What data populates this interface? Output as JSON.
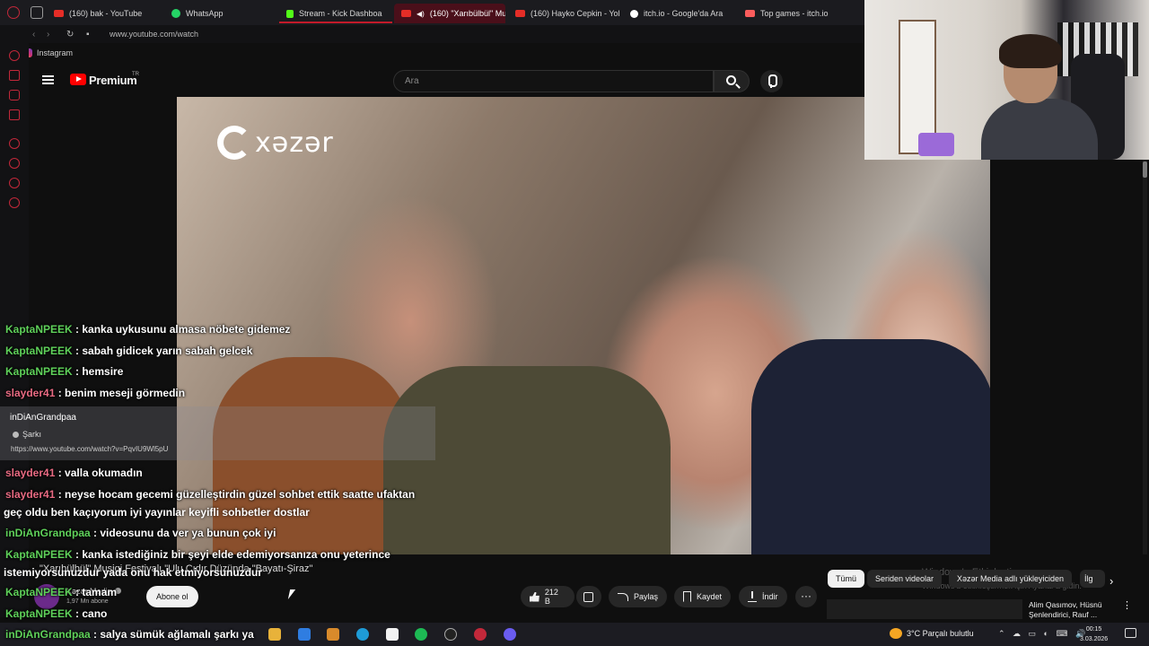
{
  "browser": {
    "tabs": [
      {
        "label": "(160) bak - YouTube",
        "fav": "#e52d27"
      },
      {
        "label": "WhatsApp",
        "fav": "#25d366"
      },
      {
        "label": "Stream - Kick Dashboa",
        "fav": "#53fc18"
      },
      {
        "label": "(160) \"Xarıbülbül\" Mus",
        "fav": "#e52d27",
        "active": true
      },
      {
        "label": "(160) Hayko Cepkin - Yol",
        "fav": "#e52d27"
      },
      {
        "label": "itch.io - Google'da Ara",
        "fav": "#ffffff"
      },
      {
        "label": "Top games - itch.io",
        "fav": "#fa5c5c"
      }
    ],
    "url": "www.youtube.com/watch",
    "bookmark": "Instagram"
  },
  "youtube": {
    "brand": "Premium",
    "brand_sup": "TR",
    "search_placeholder": "Ara",
    "channel_watermark": "xəzər",
    "video_title": "\"Xarıbülbül\" Musiqi Festivalı \"Ulu Cıdır Düzündə \"Bayatı-Şiraz\"",
    "channel": {
      "name": "Xəzər Media",
      "subs": "1,97 Mn abone"
    },
    "subscribe": "Abone ol",
    "likes": "212 B",
    "share": "Paylaş",
    "save": "Kaydet",
    "download": "İndir",
    "more": "···",
    "chips": [
      "Tümü",
      "Seriden videolar",
      "Xəzər Media adlı yükleyiciden",
      "İlg"
    ],
    "rec_title_1": "Alim Qasımov, Hüsnü",
    "rec_title_2": "Şenlendirici, Rauf ...",
    "activation_1": "Windows'u Etkinleştir",
    "activation_2": "Windows'u etkinleştirmek için Ayarlar'a gidin."
  },
  "chat": {
    "messages": [
      {
        "user": "KaptaNPEEK",
        "text": " : kanka uykusunu almasa nöbete gidemez",
        "color": "green"
      },
      {
        "user": "KaptaNPEEK",
        "text": " : sabah gidicek yarın sabah gelcek",
        "color": "green"
      },
      {
        "user": "KaptaNPEEK",
        "text": " : hemsire",
        "color": "green"
      },
      {
        "user": "slayder41",
        "text": " : benim meseji görmedin",
        "color": "pink"
      },
      {
        "user": "slayder41",
        "text": " : valla okumadın",
        "color": "pink"
      },
      {
        "user": "slayder41",
        "text": " : neyse hocam gecemi güzelleştirdin güzel sohbet ettik saatte ufaktan",
        "color": "pink"
      },
      {
        "user": "inDiAnGrandpaa",
        "text": " : videosunu da ver ya bunun çok iyi",
        "color": "green"
      },
      {
        "user": "KaptaNPEEK",
        "text": " : kanka istediğiniz bir şeyi elde edemiyorsanıza onu yeterince",
        "color": "green"
      },
      {
        "user": "KaptaNPEEK",
        "text": " : tamam",
        "color": "green"
      },
      {
        "user": "KaptaNPEEK",
        "text": " : cano",
        "color": "green"
      },
      {
        "user": "inDiAnGrandpaa",
        "text": " : salya sümük ağlamalı şarkı ya",
        "color": "green"
      }
    ],
    "continuations": [
      "geç oldu ben kaçıyorum iyi yayınlar keyifli sohbetler dostlar",
      "istemiyorsunuzdur yada onu hak etmiyorsunuzdur"
    ],
    "card": {
      "user": "inDiAnGrandpaa",
      "label": "Şarkı",
      "url": "https://www.youtube.com/watch?v=PqvIU9Wl5pU"
    }
  },
  "taskbar": {
    "weather": "3°C  Parçalı bulutlu",
    "time": "00:15",
    "date": "3.03.2026",
    "tray": "⌃ ☁ ▭ ◐ ⌨ 🔊"
  }
}
